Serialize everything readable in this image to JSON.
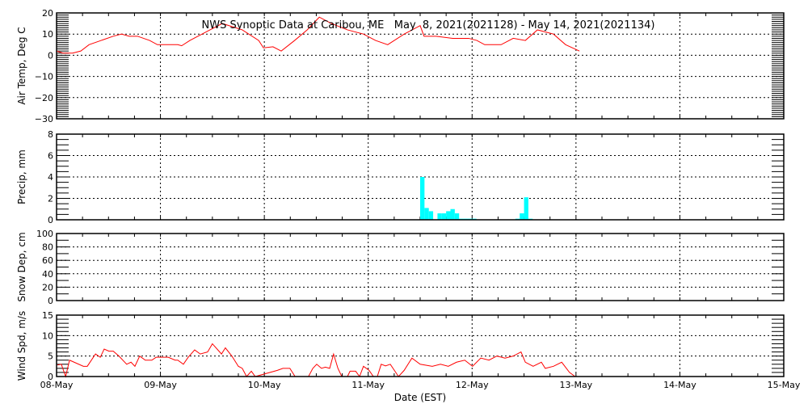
{
  "chart_data": {
    "title": "NWS Synoptic Data at Caribou, ME   May  8, 2021(2021128) - May 14, 2021(2021134)",
    "xlabel": "Date (EST)",
    "x_unit": "hours since 08-May 00:00",
    "xlim": [
      0,
      168
    ],
    "x_tick_labels": [
      "08-May",
      "09-May",
      "10-May",
      "11-May",
      "12-May",
      "13-May",
      "14-May",
      "15-May"
    ],
    "grid": true,
    "colors": {
      "line": "#ff0000",
      "bar": "#00ffff",
      "axis": "#000000"
    },
    "panels": [
      {
        "name": "air-temp",
        "type": "line",
        "ylabel": "Air Temp, Deg C",
        "ylim": [
          -30,
          20
        ],
        "y_tick_labels": [
          "20",
          "10",
          "0",
          "−10",
          "−20",
          "−30"
        ],
        "y_ticks": [
          20,
          10,
          0,
          -10,
          -20,
          -30
        ],
        "x": [
          0,
          1.5,
          3.7,
          5.6,
          7.5,
          10.3,
          13.1,
          15,
          16.8,
          18.7,
          21.5,
          23.3,
          28,
          28.9,
          30.8,
          33.6,
          36.4,
          38.3,
          42.9,
          46.7,
          47.8,
          50,
          51.9,
          55,
          57.9,
          60.7,
          63.5,
          67.2,
          70.9,
          73.7,
          76.5,
          80.3,
          84,
          84.9,
          87.7,
          91.5,
          95.2,
          97.1,
          98.9,
          102.7,
          105.5,
          108.3,
          111.1,
          114.8,
          117.6,
          120.8
        ],
        "values": [
          2,
          1,
          1,
          2,
          5,
          7,
          9,
          10,
          9,
          9,
          7,
          5,
          5,
          4.5,
          7,
          10,
          13,
          15,
          12,
          7,
          3.5,
          4,
          2,
          7,
          12,
          18,
          15,
          12,
          10,
          7,
          5,
          10,
          14,
          9,
          9,
          8,
          8,
          7,
          5,
          5,
          8,
          7,
          12,
          10,
          5,
          2
        ]
      },
      {
        "name": "precip",
        "type": "bar",
        "ylabel": "Precip, mm",
        "ylim": [
          0,
          8
        ],
        "y_tick_labels": [
          "8",
          "6",
          "4",
          "2",
          "0"
        ],
        "y_ticks": [
          8,
          6,
          4,
          2,
          0
        ],
        "x": [
          84,
          85,
          86,
          88,
          89,
          90,
          91,
          92,
          93,
          94,
          95,
          96,
          106,
          107,
          108,
          109
        ],
        "values": [
          4,
          1.1,
          0.8,
          0.6,
          0.6,
          0.8,
          1.0,
          0.6,
          0.1,
          0.1,
          0.1,
          0.1,
          0.1,
          0.6,
          2.1,
          0.1
        ]
      },
      {
        "name": "snow-depth",
        "type": "line",
        "ylabel": "Snow Dep, cm",
        "ylim": [
          0,
          100
        ],
        "y_tick_labels": [
          "100",
          "80",
          "60",
          "40",
          "20",
          "0"
        ],
        "y_ticks": [
          100,
          80,
          60,
          40,
          20,
          0
        ],
        "x": [],
        "values": []
      },
      {
        "name": "wind-speed",
        "type": "line",
        "ylabel": "Wind Spd, m/s",
        "ylim": [
          0,
          15
        ],
        "y_tick_labels": [
          "15",
          "10",
          "5",
          "0"
        ],
        "y_ticks": [
          15,
          10,
          5,
          0
        ],
        "x": [
          0.2,
          1.1,
          2.1,
          3,
          6.2,
          7.1,
          9,
          10.1,
          11,
          12.1,
          13.1,
          14.4,
          16.2,
          17.2,
          18.1,
          19.2,
          20.5,
          22,
          23,
          25.8,
          27.4,
          28,
          29.3,
          30.4,
          31.9,
          33.2,
          34.9,
          36,
          38.1,
          39,
          40.5,
          42,
          42.9,
          43.9,
          45,
          45.9,
          51,
          52.3,
          53.9,
          55.1,
          58.2,
          59.2,
          60.1,
          61.2,
          62.1,
          63.1,
          64,
          65,
          65.9,
          67.2,
          67.8,
          69.1,
          70,
          70.9,
          72.2,
          73.2,
          74.1,
          75,
          76,
          77.1,
          79,
          80.3,
          82.1,
          84,
          86.8,
          88.7,
          90.5,
          92.4,
          94.3,
          96.1,
          98,
          99.9,
          101.7,
          103.6,
          105.5,
          107.3,
          108.3,
          110.1,
          112,
          112.9,
          114.8,
          116.7,
          118.5,
          119.8
        ],
        "values": [
          2.8,
          3,
          0,
          4,
          2.5,
          2.5,
          5.5,
          4.7,
          6.7,
          6.2,
          6.2,
          5,
          3,
          3.5,
          2.5,
          5,
          4,
          4,
          4.7,
          4.7,
          4,
          4,
          3,
          4.7,
          6.5,
          5.5,
          6,
          8,
          5.5,
          7,
          5,
          2.5,
          2,
          0,
          1.3,
          0,
          1.5,
          2,
          2,
          0,
          0,
          2,
          3,
          2,
          2.3,
          2,
          5.5,
          2,
          0,
          0,
          1.3,
          1.3,
          0,
          2.5,
          1.5,
          0,
          0,
          3,
          2.6,
          3,
          0,
          1.5,
          4.5,
          3,
          2.5,
          3,
          2.5,
          3.5,
          4,
          2.5,
          4.5,
          4,
          5,
          4.5,
          5,
          6,
          3.5,
          2.5,
          3.5,
          2,
          2.5,
          3.5,
          1,
          0
        ]
      }
    ]
  }
}
